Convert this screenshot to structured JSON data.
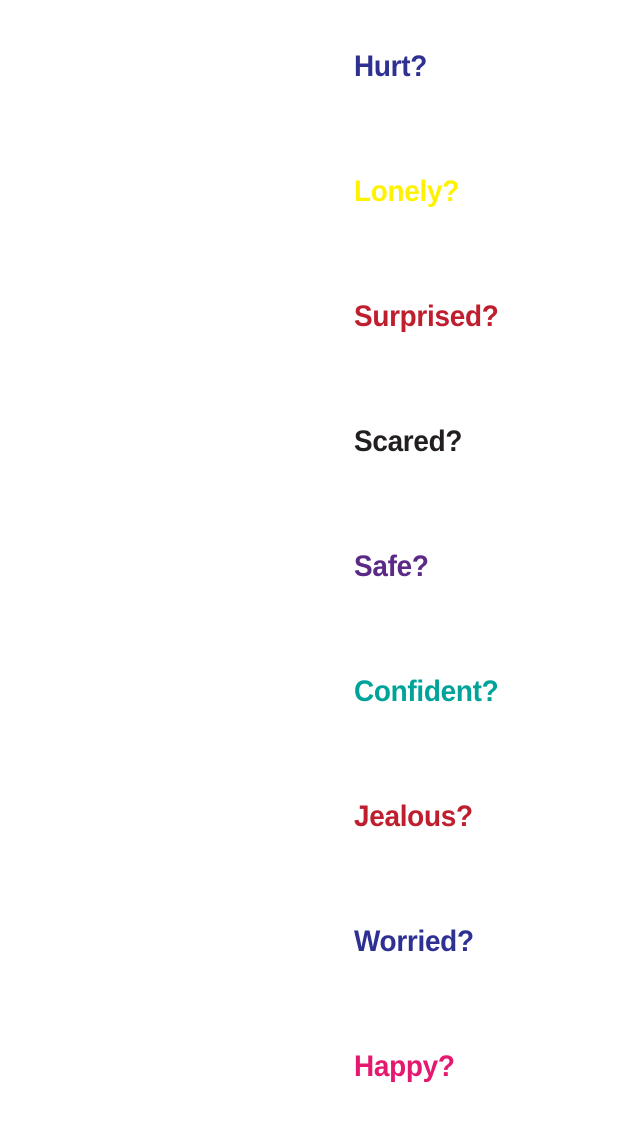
{
  "feelings": [
    {
      "label": "Hurt?",
      "color": "#2e3192"
    },
    {
      "label": "Lonely?",
      "color": "#fff200"
    },
    {
      "label": "Surprised?",
      "color": "#be1e2d"
    },
    {
      "label": "Scared?",
      "color": "#231f20"
    },
    {
      "label": "Safe?",
      "color": "#5b2a86"
    },
    {
      "label": "Confident?",
      "color": "#00a39a"
    },
    {
      "label": "Jealous?",
      "color": "#be1e2d"
    },
    {
      "label": "Worried?",
      "color": "#2e3192"
    },
    {
      "label": "Happy?",
      "color": "#e6176e"
    }
  ]
}
